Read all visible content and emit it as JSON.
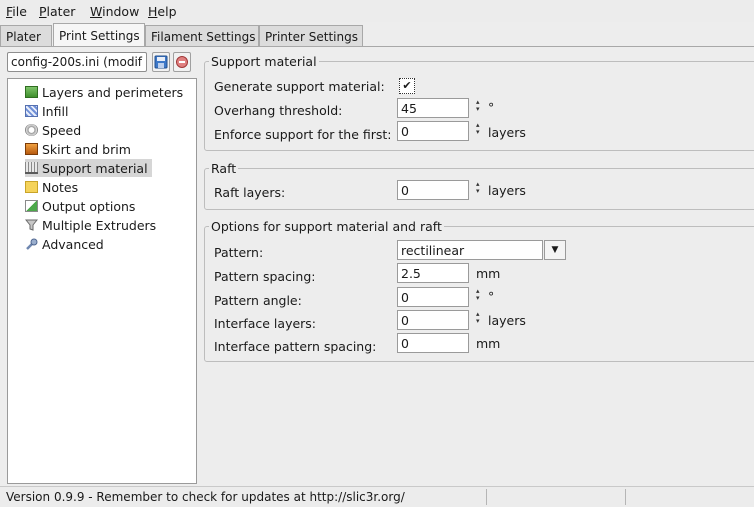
{
  "menu": [
    {
      "accel": "F",
      "rest": "ile"
    },
    {
      "accel": "P",
      "rest": "later"
    },
    {
      "accel": "W",
      "rest": "indow"
    },
    {
      "accel": "H",
      "rest": "elp"
    }
  ],
  "tabs": [
    "Plater",
    "Print Settings",
    "Filament Settings",
    "Printer Settings"
  ],
  "active_tab": "Print Settings",
  "preset": {
    "value": "config-200s.ini (modif"
  },
  "icons": {
    "save": "save-disk-icon",
    "delete": "delete-icon"
  },
  "tree": [
    {
      "label": "Layers and perimeters",
      "icon": "layers-icon"
    },
    {
      "label": "Infill",
      "icon": "infill-icon"
    },
    {
      "label": "Speed",
      "icon": "speed-icon"
    },
    {
      "label": "Skirt and brim",
      "icon": "skirt-icon"
    },
    {
      "label": "Support material",
      "icon": "support-icon",
      "selected": true
    },
    {
      "label": "Notes",
      "icon": "notes-icon"
    },
    {
      "label": "Output options",
      "icon": "output-icon"
    },
    {
      "label": "Multiple Extruders",
      "icon": "funnel-icon"
    },
    {
      "label": "Advanced",
      "icon": "wrench-icon"
    }
  ],
  "support": {
    "title": "Support material",
    "generate_label": "Generate support material:",
    "generate_checked": true,
    "overhang_label": "Overhang threshold:",
    "overhang_value": "45",
    "overhang_unit": "°",
    "enforce_label": "Enforce support for the first:",
    "enforce_value": "0",
    "enforce_unit": "layers"
  },
  "raft": {
    "title": "Raft",
    "layers_label": "Raft layers:",
    "layers_value": "0",
    "layers_unit": "layers"
  },
  "options": {
    "title": "Options for support material and raft",
    "pattern_label": "Pattern:",
    "pattern_value": "rectilinear",
    "spacing_label": "Pattern spacing:",
    "spacing_value": "2.5",
    "spacing_unit": "mm",
    "angle_label": "Pattern angle:",
    "angle_value": "0",
    "angle_unit": "°",
    "iface_layers_label": "Interface layers:",
    "iface_layers_value": "0",
    "iface_layers_unit": "layers",
    "iface_spacing_label": "Interface pattern spacing:",
    "iface_spacing_value": "0",
    "iface_spacing_unit": "mm"
  },
  "status": {
    "text": "Version 0.9.9 - Remember to check for updates at http://slic3r.org/"
  }
}
